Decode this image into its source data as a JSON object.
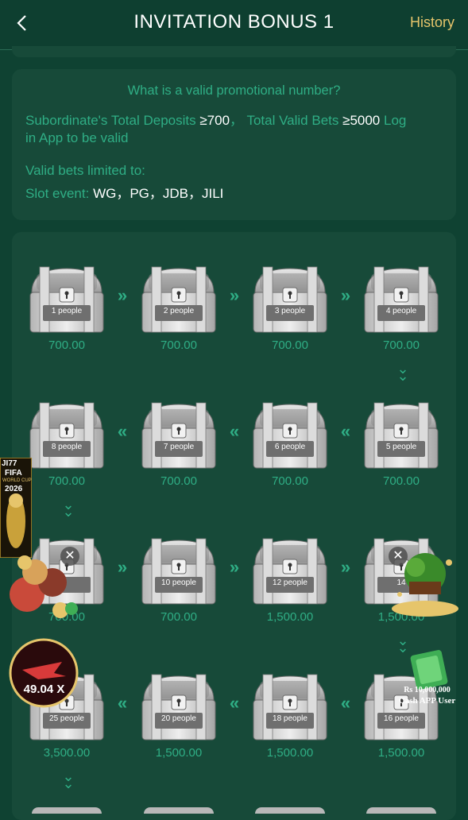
{
  "header": {
    "title": "INVITATION BONUS 1",
    "history_label": "History"
  },
  "info": {
    "question": "What is a valid promotional number?",
    "req_part1": "Subordinate's Total Deposits ",
    "req_dep": "≥700",
    "req_part2": "， Total Valid Bets ",
    "req_bets": "≥5000",
    "req_part3": " Log",
    "req_line2": "in App to be valid",
    "limited": "Valid bets limited to:",
    "slot_label": "Slot event: ",
    "slot_values": "WG，PG，JDB，JILI"
  },
  "rewards": [
    {
      "people": "1 people",
      "amount": "700.00"
    },
    {
      "people": "2 people",
      "amount": "700.00"
    },
    {
      "people": "3 people",
      "amount": "700.00"
    },
    {
      "people": "4 people",
      "amount": "700.00"
    },
    {
      "people": "5 people",
      "amount": "700.00"
    },
    {
      "people": "6 people",
      "amount": "700.00"
    },
    {
      "people": "7 people",
      "amount": "700.00"
    },
    {
      "people": "8 people",
      "amount": "700.00"
    },
    {
      "people": "",
      "amount": "700.00"
    },
    {
      "people": "10 people",
      "amount": "700.00"
    },
    {
      "people": "12 people",
      "amount": "1,500.00"
    },
    {
      "people": "14",
      "amount": "1,500.00"
    },
    {
      "people": "16 people",
      "amount": "1,500.00"
    },
    {
      "people": "18 people",
      "amount": "1,500.00"
    },
    {
      "people": "20 people",
      "amount": "1,500.00"
    },
    {
      "people": "25 people",
      "amount": "3,500.00"
    }
  ],
  "overlays": {
    "fifa_brand": "JI77",
    "fifa_title": "FIFA",
    "fifa_sub": "WORLD CUP",
    "fifa_year": "2026",
    "multiplier": "49.04 X",
    "cash_amount": "Rs 10,000,000",
    "cash_label": "Cash APP User"
  },
  "icons": {
    "back": "chevron-left-icon",
    "right": "double-chevron-right-icon",
    "left": "double-chevron-left-icon",
    "down": "double-chevron-down-icon",
    "close": "close-icon"
  },
  "colors": {
    "background": "#0f4232",
    "card": "#174a39",
    "accent": "#2fae85",
    "history": "#e6c56b"
  }
}
